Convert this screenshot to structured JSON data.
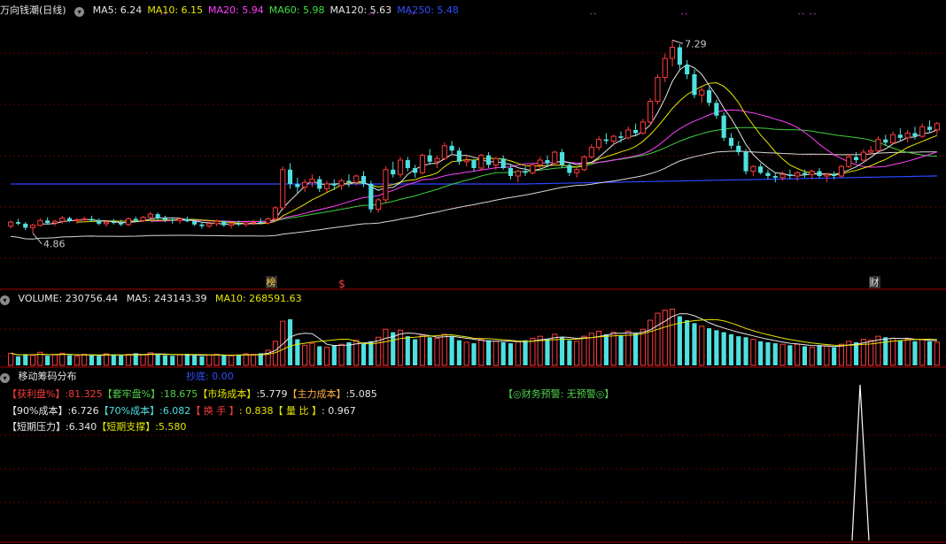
{
  "header": {
    "title": "万向钱潮(日线)",
    "ma": [
      {
        "label": "MA5: 6.24",
        "color": "#e6e6e6"
      },
      {
        "label": "MA10: 6.15",
        "color": "#e6e600"
      },
      {
        "label": "MA20: 5.94",
        "color": "#ff40ff"
      },
      {
        "label": "MA60: 5.98",
        "color": "#40e040"
      },
      {
        "label": "MA120: 5.63",
        "color": "#e6e6e6"
      },
      {
        "label": "MA250: 5.48",
        "color": "#3050ff"
      }
    ]
  },
  "markers": {
    "high": "7.29",
    "low": "4.86",
    "bang": "榜",
    "dollar": "$",
    "cai": "财"
  },
  "volume_header": {
    "volume": "VOLUME: 230756.44",
    "ma5": "MA5: 243143.39",
    "ma10": "MA10: 268591.63"
  },
  "chip": {
    "title": "移动筹码分布",
    "chaodi": "抄底: 0.00",
    "warning": "【◎财务预警: 无预警◎】",
    "row1": [
      {
        "text": "【获利盘%】",
        "color": "r"
      },
      {
        "text": ":81.325",
        "color": "r"
      },
      {
        "text": "【套牢盘%】",
        "color": "g"
      },
      {
        "text": ":18.675",
        "color": "g"
      },
      {
        "text": "【市场成本】",
        "color": "y"
      },
      {
        "text": ":5.779",
        "color": "w"
      },
      {
        "text": "【主力成本】",
        "color": "o"
      },
      {
        "text": ":5.085",
        "color": "w"
      }
    ],
    "row2": [
      {
        "text": "【90%成本】",
        "color": "w"
      },
      {
        "text": ":6.726",
        "color": "w"
      },
      {
        "text": "【70%成本】",
        "color": "c"
      },
      {
        "text": ":6.082",
        "color": "c"
      },
      {
        "text": "【 换 手 】",
        "color": "r"
      },
      {
        "text": ":  0.838",
        "color": "y"
      },
      {
        "text": "【 量 比 】",
        "color": "y"
      },
      {
        "text": ":  0.967",
        "color": "w"
      }
    ],
    "row3": [
      {
        "text": "【短期压力】",
        "color": "w"
      },
      {
        "text": ":6.340",
        "color": "w"
      },
      {
        "text": "【短期支撑】",
        "color": "y"
      },
      {
        "text": ":5.580",
        "color": "y"
      }
    ]
  },
  "chart_data": {
    "type": "candlestick",
    "title": "万向钱潮(日线)",
    "ylim": [
      4.4,
      7.55
    ],
    "high": 7.29,
    "low": 4.86,
    "ohlc": [
      [
        4.95,
        5.02,
        4.92,
        5.0
      ],
      [
        5.0,
        5.04,
        4.96,
        4.98
      ],
      [
        4.98,
        5.0,
        4.9,
        4.93
      ],
      [
        4.93,
        4.98,
        4.86,
        4.96
      ],
      [
        4.96,
        5.05,
        4.94,
        5.02
      ],
      [
        5.02,
        5.06,
        4.97,
        4.99
      ],
      [
        4.99,
        5.03,
        4.95,
        5.01
      ],
      [
        5.01,
        5.08,
        4.98,
        5.05
      ],
      [
        5.05,
        5.07,
        5.0,
        5.02
      ],
      [
        5.02,
        5.05,
        4.98,
        5.03
      ],
      [
        5.03,
        5.07,
        5.0,
        5.04
      ],
      [
        5.04,
        5.08,
        5.0,
        5.02
      ],
      [
        5.02,
        5.05,
        4.96,
        4.98
      ],
      [
        4.98,
        5.02,
        4.94,
        5.0
      ],
      [
        5.0,
        5.04,
        4.97,
        4.99
      ],
      [
        4.99,
        5.03,
        4.95,
        4.97
      ],
      [
        4.97,
        5.06,
        4.95,
        5.04
      ],
      [
        5.04,
        5.07,
        5.0,
        5.02
      ],
      [
        5.02,
        5.08,
        5.0,
        5.06
      ],
      [
        5.06,
        5.13,
        5.04,
        5.1
      ],
      [
        5.1,
        5.12,
        5.03,
        5.05
      ],
      [
        5.05,
        5.08,
        5.0,
        5.03
      ],
      [
        5.03,
        5.06,
        4.98,
        5.02
      ],
      [
        5.02,
        5.05,
        4.98,
        5.04
      ],
      [
        5.04,
        5.07,
        5.0,
        5.01
      ],
      [
        5.01,
        5.04,
        4.95,
        4.97
      ],
      [
        4.97,
        5.0,
        4.92,
        4.95
      ],
      [
        4.95,
        5.0,
        4.93,
        4.98
      ],
      [
        4.98,
        5.03,
        4.95,
        5.01
      ],
      [
        5.01,
        5.02,
        4.94,
        4.96
      ],
      [
        4.96,
        5.0,
        4.92,
        4.98
      ],
      [
        4.98,
        5.02,
        4.95,
        4.97
      ],
      [
        4.97,
        5.01,
        4.94,
        4.99
      ],
      [
        4.99,
        5.03,
        4.96,
        5.0
      ],
      [
        5.0,
        5.05,
        4.97,
        4.99
      ],
      [
        4.99,
        5.06,
        4.97,
        5.04
      ],
      [
        5.04,
        5.2,
        5.02,
        5.18
      ],
      [
        5.18,
        5.7,
        5.15,
        5.66
      ],
      [
        5.66,
        5.74,
        5.42,
        5.48
      ],
      [
        5.48,
        5.56,
        5.36,
        5.44
      ],
      [
        5.44,
        5.54,
        5.38,
        5.5
      ],
      [
        5.5,
        5.6,
        5.44,
        5.54
      ],
      [
        5.54,
        5.58,
        5.38,
        5.42
      ],
      [
        5.42,
        5.52,
        5.38,
        5.48
      ],
      [
        5.48,
        5.54,
        5.4,
        5.46
      ],
      [
        5.46,
        5.55,
        5.4,
        5.52
      ],
      [
        5.52,
        5.6,
        5.44,
        5.5
      ],
      [
        5.5,
        5.6,
        5.46,
        5.58
      ],
      [
        5.58,
        5.64,
        5.44,
        5.48
      ],
      [
        5.48,
        5.52,
        5.12,
        5.16
      ],
      [
        5.16,
        5.3,
        5.12,
        5.28
      ],
      [
        5.28,
        5.7,
        5.24,
        5.66
      ],
      [
        5.66,
        5.76,
        5.56,
        5.6
      ],
      [
        5.6,
        5.82,
        5.56,
        5.78
      ],
      [
        5.78,
        5.82,
        5.64,
        5.68
      ],
      [
        5.68,
        5.72,
        5.56,
        5.62
      ],
      [
        5.62,
        5.86,
        5.6,
        5.84
      ],
      [
        5.84,
        5.92,
        5.72,
        5.76
      ],
      [
        5.76,
        5.84,
        5.68,
        5.8
      ],
      [
        5.8,
        6.0,
        5.78,
        5.96
      ],
      [
        5.96,
        6.02,
        5.86,
        5.9
      ],
      [
        5.9,
        5.94,
        5.72,
        5.76
      ],
      [
        5.76,
        5.84,
        5.7,
        5.78
      ],
      [
        5.78,
        5.8,
        5.64,
        5.68
      ],
      [
        5.68,
        5.86,
        5.64,
        5.84
      ],
      [
        5.84,
        5.88,
        5.68,
        5.72
      ],
      [
        5.72,
        5.82,
        5.66,
        5.8
      ],
      [
        5.8,
        5.84,
        5.66,
        5.68
      ],
      [
        5.68,
        5.72,
        5.54,
        5.58
      ],
      [
        5.58,
        5.66,
        5.5,
        5.64
      ],
      [
        5.64,
        5.7,
        5.58,
        5.62
      ],
      [
        5.62,
        5.74,
        5.6,
        5.72
      ],
      [
        5.72,
        5.82,
        5.66,
        5.78
      ],
      [
        5.78,
        5.84,
        5.7,
        5.74
      ],
      [
        5.74,
        5.9,
        5.72,
        5.88
      ],
      [
        5.88,
        5.92,
        5.68,
        5.72
      ],
      [
        5.72,
        5.76,
        5.58,
        5.62
      ],
      [
        5.62,
        5.7,
        5.56,
        5.66
      ],
      [
        5.66,
        5.84,
        5.64,
        5.82
      ],
      [
        5.82,
        5.98,
        5.8,
        5.94
      ],
      [
        5.94,
        6.08,
        5.9,
        6.04
      ],
      [
        6.04,
        6.12,
        5.98,
        6.02
      ],
      [
        6.02,
        6.1,
        5.96,
        6.08
      ],
      [
        6.08,
        6.14,
        6.0,
        6.06
      ],
      [
        6.06,
        6.2,
        6.04,
        6.16
      ],
      [
        6.16,
        6.24,
        6.08,
        6.12
      ],
      [
        6.12,
        6.3,
        6.1,
        6.26
      ],
      [
        6.26,
        6.56,
        6.22,
        6.52
      ],
      [
        6.52,
        6.86,
        6.48,
        6.82
      ],
      [
        6.82,
        7.12,
        6.76,
        7.06
      ],
      [
        7.06,
        7.29,
        6.96,
        7.2
      ],
      [
        7.2,
        7.24,
        6.92,
        6.98
      ],
      [
        6.98,
        7.04,
        6.8,
        6.86
      ],
      [
        6.86,
        6.92,
        6.56,
        6.6
      ],
      [
        6.6,
        6.7,
        6.5,
        6.66
      ],
      [
        6.66,
        6.7,
        6.46,
        6.5
      ],
      [
        6.5,
        6.54,
        6.3,
        6.34
      ],
      [
        6.34,
        6.38,
        6.02,
        6.06
      ],
      [
        6.06,
        6.12,
        5.92,
        5.96
      ],
      [
        5.96,
        6.02,
        5.84,
        5.88
      ],
      [
        5.88,
        5.92,
        5.6,
        5.64
      ],
      [
        5.64,
        5.72,
        5.58,
        5.7
      ],
      [
        5.7,
        5.74,
        5.6,
        5.62
      ],
      [
        5.62,
        5.66,
        5.54,
        5.58
      ],
      [
        5.58,
        5.62,
        5.5,
        5.56
      ],
      [
        5.56,
        5.64,
        5.52,
        5.6
      ],
      [
        5.6,
        5.66,
        5.54,
        5.58
      ],
      [
        5.58,
        5.64,
        5.52,
        5.62
      ],
      [
        5.62,
        5.66,
        5.56,
        5.6
      ],
      [
        5.6,
        5.66,
        5.54,
        5.64
      ],
      [
        5.64,
        5.68,
        5.56,
        5.58
      ],
      [
        5.58,
        5.62,
        5.5,
        5.6
      ],
      [
        5.6,
        5.64,
        5.54,
        5.58
      ],
      [
        5.58,
        5.72,
        5.56,
        5.7
      ],
      [
        5.7,
        5.86,
        5.68,
        5.82
      ],
      [
        5.82,
        5.88,
        5.74,
        5.78
      ],
      [
        5.78,
        5.92,
        5.76,
        5.88
      ],
      [
        5.88,
        5.96,
        5.84,
        5.9
      ],
      [
        5.9,
        6.08,
        5.88,
        6.04
      ],
      [
        6.04,
        6.1,
        5.96,
        6.0
      ],
      [
        6.0,
        6.14,
        5.98,
        6.1
      ],
      [
        6.1,
        6.18,
        6.02,
        6.06
      ],
      [
        6.06,
        6.16,
        6.0,
        6.12
      ],
      [
        6.12,
        6.2,
        6.04,
        6.08
      ],
      [
        6.08,
        6.24,
        6.06,
        6.2
      ],
      [
        6.2,
        6.28,
        6.12,
        6.16
      ],
      [
        6.16,
        6.26,
        6.1,
        6.24
      ]
    ],
    "volume": [
      24,
      18,
      22,
      20,
      26,
      19,
      21,
      24,
      20,
      18,
      22,
      20,
      19,
      23,
      21,
      20,
      22,
      24,
      21,
      25,
      22,
      20,
      19,
      21,
      23,
      20,
      18,
      21,
      22,
      20,
      19,
      21,
      23,
      22,
      24,
      30,
      48,
      88,
      92,
      52,
      40,
      44,
      38,
      36,
      40,
      42,
      46,
      50,
      44,
      48,
      56,
      72,
      66,
      70,
      58,
      52,
      60,
      56,
      54,
      62,
      58,
      50,
      46,
      44,
      52,
      50,
      48,
      46,
      44,
      48,
      50,
      54,
      58,
      52,
      62,
      56,
      50,
      48,
      58,
      64,
      68,
      62,
      66,
      60,
      68,
      64,
      72,
      90,
      104,
      110,
      112,
      98,
      90,
      84,
      78,
      74,
      70,
      66,
      62,
      58,
      56,
      52,
      48,
      46,
      44,
      42,
      40,
      42,
      38,
      36,
      40,
      38,
      36,
      42,
      48,
      46,
      52,
      50,
      58,
      56,
      54,
      50,
      52,
      48,
      52,
      48,
      46
    ],
    "volume_max": 120
  }
}
